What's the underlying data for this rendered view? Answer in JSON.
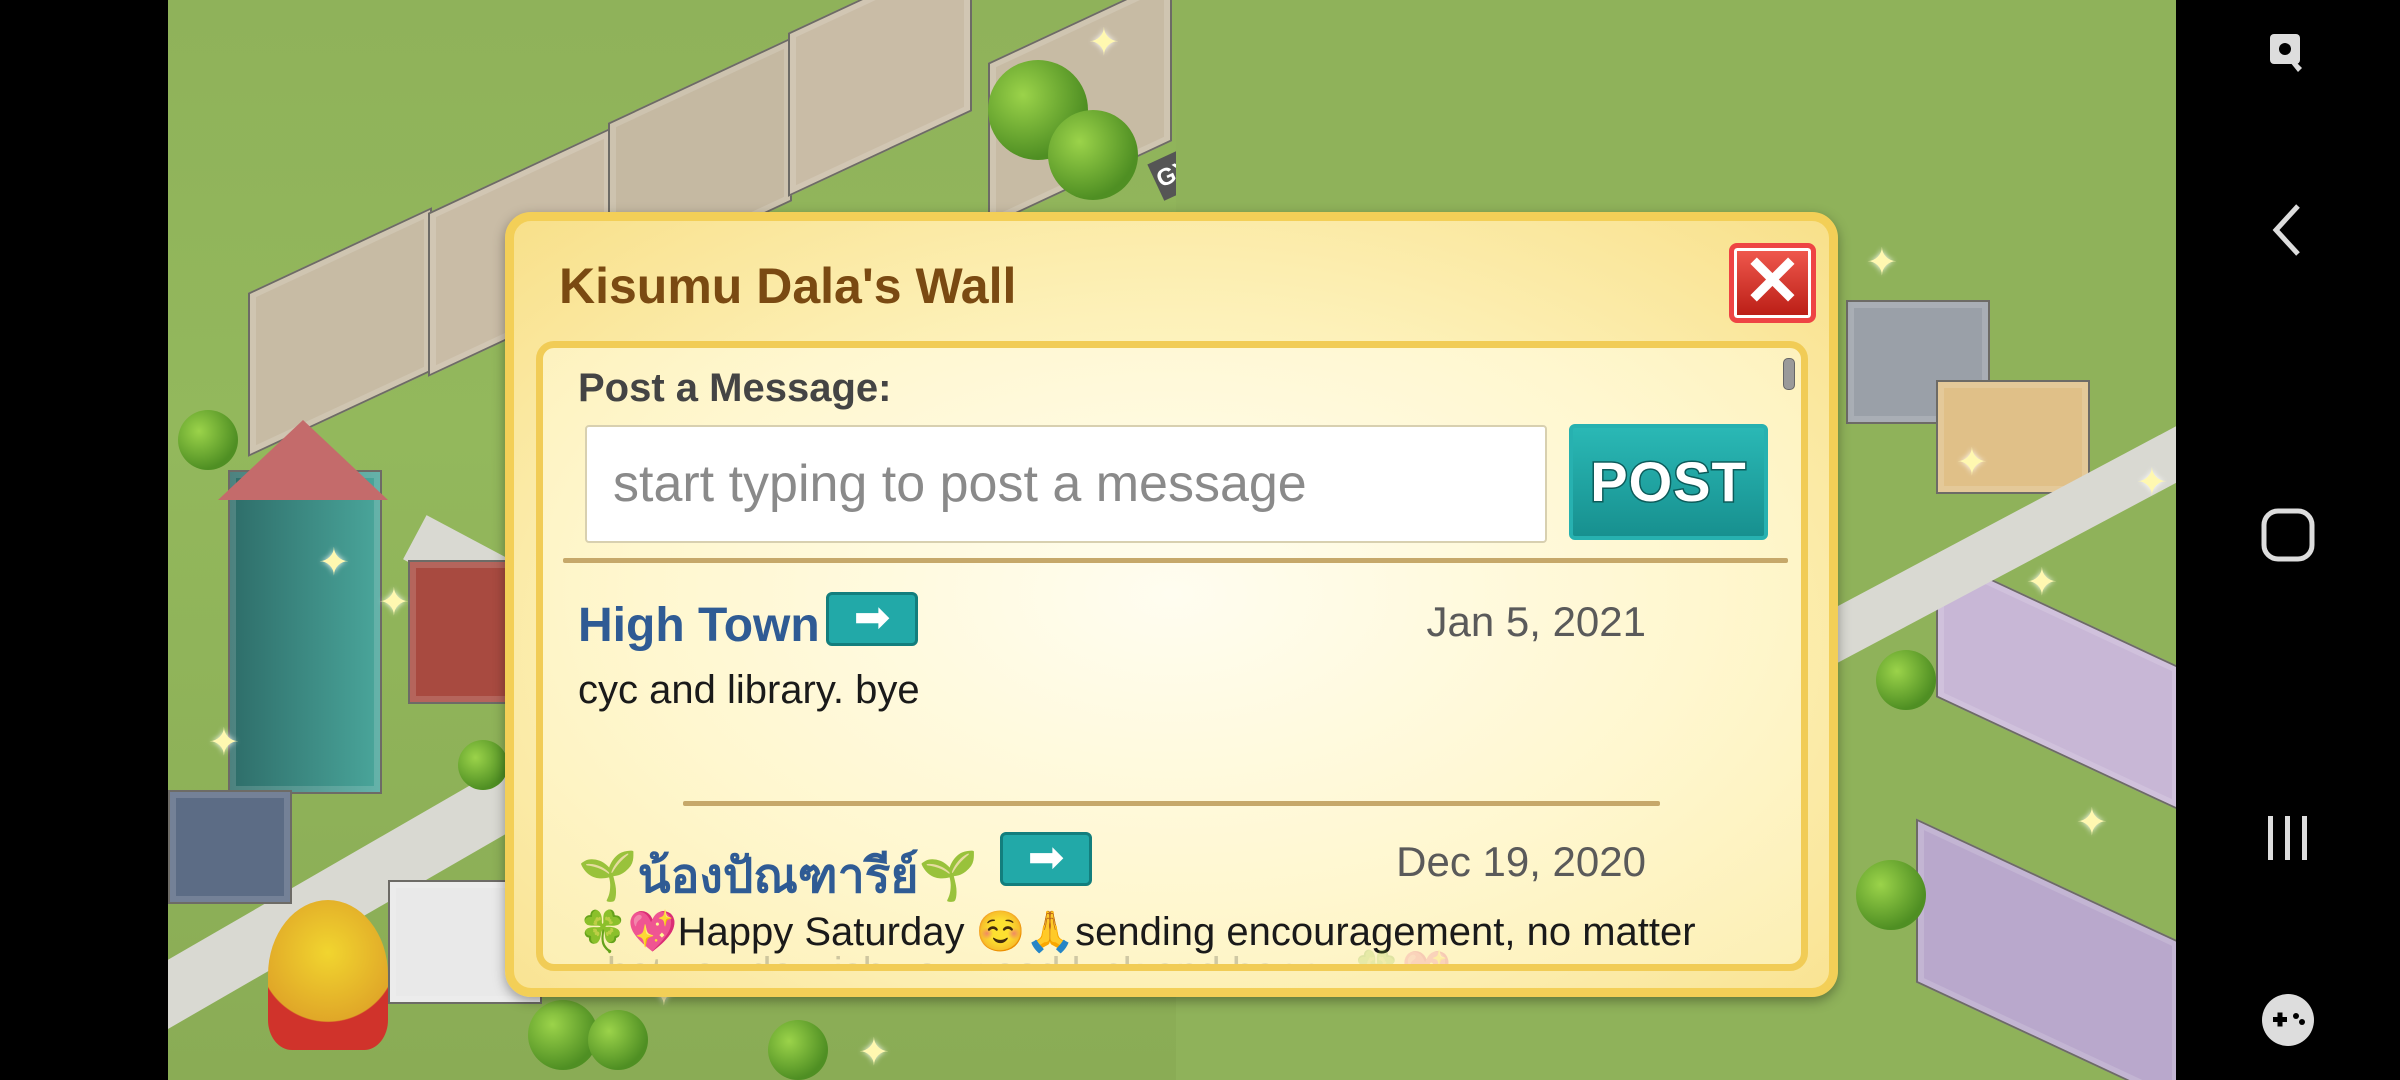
{
  "dialog": {
    "title": "Kisumu Dala's Wall",
    "close_icon": "close-x-icon",
    "post_label": "Post a Message:",
    "input_placeholder": "start typing to post a message",
    "input_value": "",
    "post_button_label": "POST"
  },
  "posts": [
    {
      "author": "High Town",
      "date": "Jan 5, 2021",
      "body": "cyc and library. bye",
      "go_icon": "arrow-right-icon"
    },
    {
      "author": "🌱น้องปัณฑารีย์🌱",
      "date": "Dec 19, 2020",
      "body": "🍀💖Happy Saturday ☺️🙏sending encouragement, no matter",
      "body_faded": "what you do wish you good luck and happy 🍀💖",
      "go_icon": "arrow-right-icon"
    }
  ],
  "navbar": {
    "icons": [
      "screen-capture-icon",
      "back-icon",
      "home-icon",
      "recents-icon",
      "game-tools-icon"
    ]
  },
  "game": {
    "building_sign": "GYM"
  }
}
